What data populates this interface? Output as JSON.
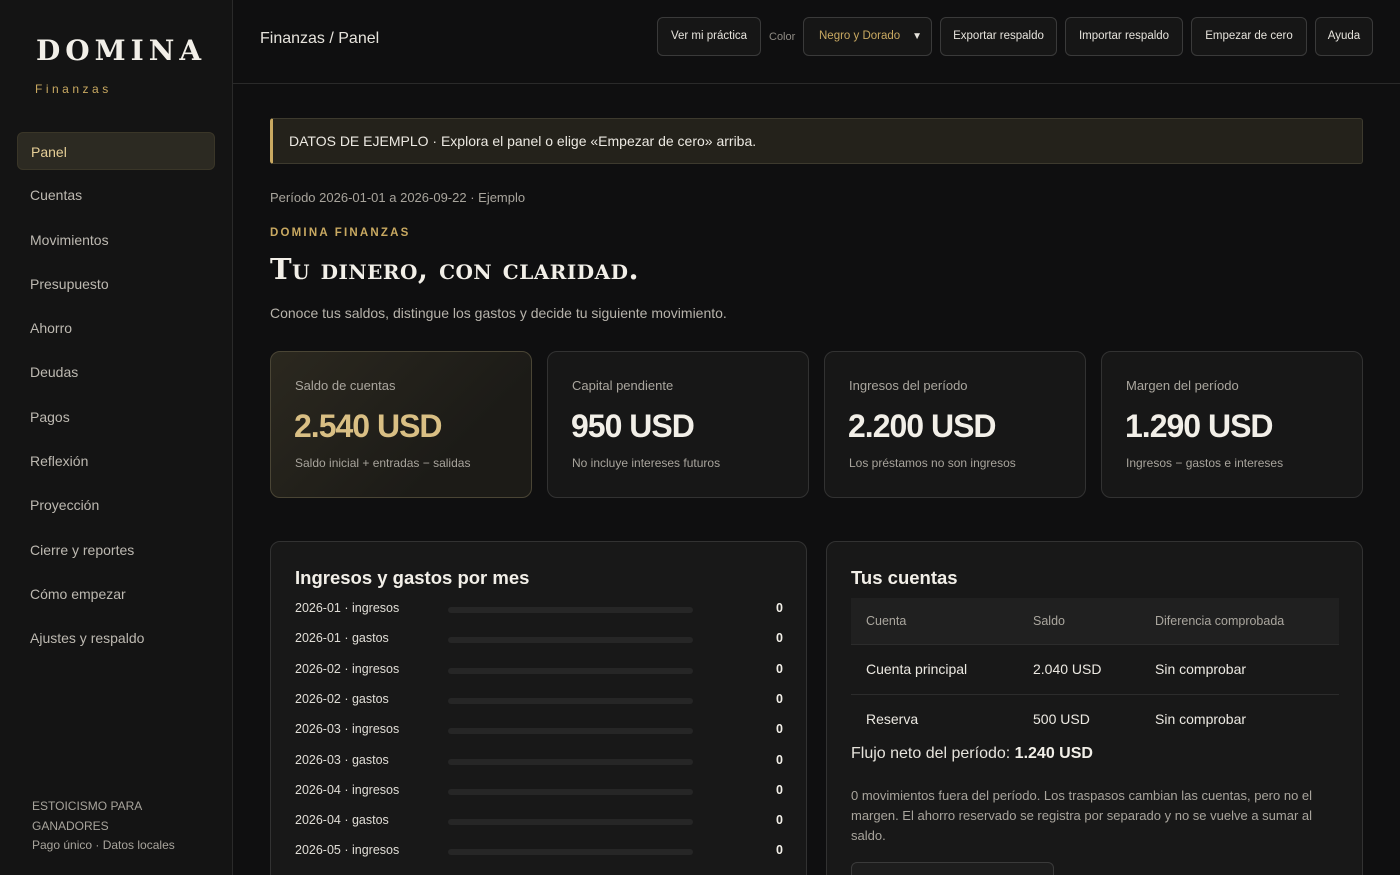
{
  "sidebar": {
    "brand": "DOMINA",
    "brand_sub": "Finanzas",
    "items": [
      {
        "label": "Panel",
        "active": true
      },
      {
        "label": "Cuentas"
      },
      {
        "label": "Movimientos"
      },
      {
        "label": "Presupuesto"
      },
      {
        "label": "Ahorro"
      },
      {
        "label": "Deudas"
      },
      {
        "label": "Pagos"
      },
      {
        "label": "Reflexión"
      },
      {
        "label": "Proyección"
      },
      {
        "label": "Cierre y reportes"
      },
      {
        "label": "Cómo empezar"
      },
      {
        "label": "Ajustes y respaldo"
      }
    ],
    "footer_line1": "ESTOICISMO PARA",
    "footer_line2": "GANADORES",
    "footer_line3": "Pago único · Datos locales"
  },
  "topbar": {
    "breadcrumb": "Finanzas / Panel",
    "practice_btn": "Ver mi práctica",
    "color_label": "Color",
    "color_value": "Negro y Dorado",
    "export_btn": "Exportar respaldo",
    "import_btn": "Importar respaldo",
    "reset_btn": "Empezar de cero",
    "help_btn": "Ayuda"
  },
  "banner": "DATOS DE EJEMPLO · Explora el panel o elige «Empezar de cero» arriba.",
  "period": "Período 2026-01-01 a 2026-09-22 · Ejemplo",
  "eyebrow": "DOMINA FINANZAS",
  "hero_title": "Tu dinero, con claridad.",
  "lead": "Conoce tus saldos, distingue los gastos y decide tu siguiente movimiento.",
  "stats": [
    {
      "label": "Saldo de cuentas",
      "value": "2.540 USD",
      "hint": "Saldo inicial + entradas − salidas"
    },
    {
      "label": "Capital pendiente",
      "value": "950 USD",
      "hint": "No incluye intereses futuros"
    },
    {
      "label": "Ingresos del período",
      "value": "2.200 USD",
      "hint": "Los préstamos no son ingresos"
    },
    {
      "label": "Margen del período",
      "value": "1.290 USD",
      "hint": "Ingresos − gastos e intereses"
    }
  ],
  "monthly": {
    "title": "Ingresos y gastos por mes",
    "rows": [
      {
        "label": "2026-01 · ingresos",
        "value": "0",
        "fill": 0
      },
      {
        "label": "2026-01 · gastos",
        "value": "0",
        "fill": 0
      },
      {
        "label": "2026-02 · ingresos",
        "value": "0",
        "fill": 0
      },
      {
        "label": "2026-02 · gastos",
        "value": "0",
        "fill": 0
      },
      {
        "label": "2026-03 · ingresos",
        "value": "0",
        "fill": 0
      },
      {
        "label": "2026-03 · gastos",
        "value": "0",
        "fill": 0
      },
      {
        "label": "2026-04 · ingresos",
        "value": "0",
        "fill": 0
      },
      {
        "label": "2026-04 · gastos",
        "value": "0",
        "fill": 0
      },
      {
        "label": "2026-05 · ingresos",
        "value": "0",
        "fill": 0
      }
    ]
  },
  "accounts": {
    "title": "Tus cuentas",
    "headers": [
      "Cuenta",
      "Saldo",
      "Diferencia comprobada"
    ],
    "rows": [
      [
        "Cuenta principal",
        "2.040 USD",
        "Sin comprobar"
      ],
      [
        "Reserva",
        "500 USD",
        "Sin comprobar"
      ]
    ],
    "flow_label": "Flujo neto del período:",
    "flow_value": "1.240 USD",
    "note": "0 movimientos fuera del período. Los traspasos cambian las cuentas, pero no el margen. El ahorro reservado se registra por separado y no se vuelve a sumar al saldo."
  }
}
